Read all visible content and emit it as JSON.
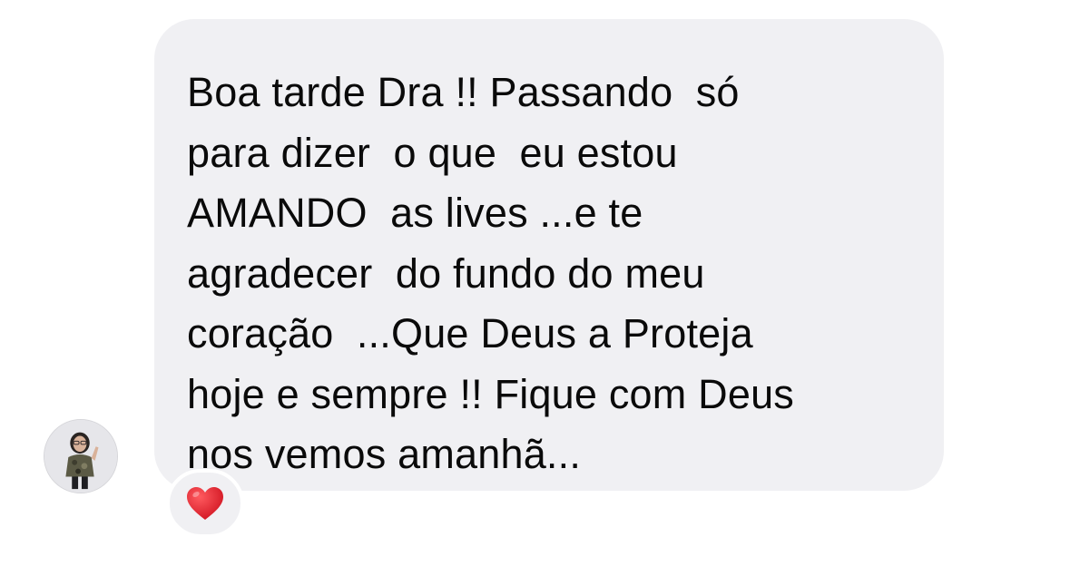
{
  "message": {
    "lines": [
      "Boa tarde Dra !! Passando  só",
      "para dizer  o que  eu estou",
      "AMANDO  as lives ...e te",
      "agradecer  do fundo do meu",
      "coração  ...Que Deus a Proteja",
      "hoje e sempre !! Fique com Deus",
      "nos vemos amanhã..."
    ]
  },
  "reaction": {
    "icon": "red-heart-icon",
    "color": "#e0242f"
  },
  "avatar": {
    "icon": "profile-photo"
  },
  "colors": {
    "bubble": "#f0f0f3",
    "text": "#0a0a0a"
  }
}
